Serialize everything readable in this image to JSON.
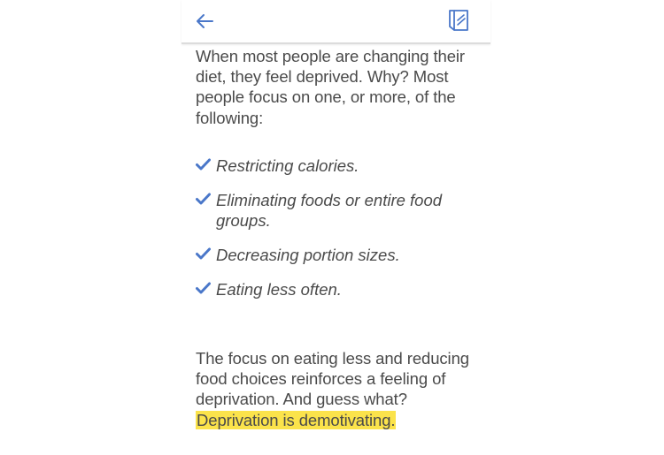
{
  "colors": {
    "accent": "#4a77c9",
    "highlight": "#fbe34b",
    "text": "#4a4a4a"
  },
  "toolbar": {
    "back_icon": "arrow-left-icon",
    "bookmark_icon": "bookmark-icon"
  },
  "article": {
    "intro": "When most people are changing their diet, they feel deprived. Why? Most people focus on one, or more, of the following:",
    "checklist": [
      "Restricting calories.",
      "Eliminating foods or entire food groups.",
      "Decreasing portion sizes.",
      "Eating less often."
    ],
    "outro_text": "The focus on eating less and reducing food choices reinforces a feeling of deprivation. And guess what?",
    "outro_highlight": "Deprivation is demotivating."
  }
}
